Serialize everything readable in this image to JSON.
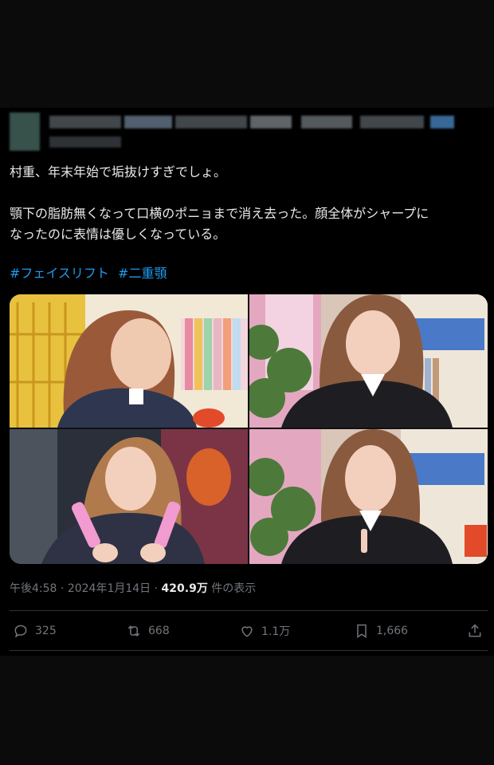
{
  "tweet": {
    "line1": "村重、年末年始で垢抜けすぎでしょ。",
    "line2a": "顎下の脂肪無くなって口横のポニョまで消え去った。顔全体がシャープに",
    "line2b": "なったのに表情は優しくなっている。",
    "hashtags": [
      "#フェイスリフト",
      "#二重顎"
    ]
  },
  "meta": {
    "time": "午後4:58",
    "sep": "·",
    "date": "2024年1月14日",
    "views": "420.9万",
    "views_suffix": "件の表示"
  },
  "actions": {
    "replies": "325",
    "reposts": "668",
    "likes": "1.1万",
    "bookmarks": "1,666"
  },
  "icons": [
    "reply-icon",
    "repost-icon",
    "like-icon",
    "bookmark-icon",
    "share-icon"
  ],
  "colors": {
    "background": "#000000",
    "text": "#e7e9ea",
    "muted": "#71767b",
    "link": "#1d9bf0"
  }
}
